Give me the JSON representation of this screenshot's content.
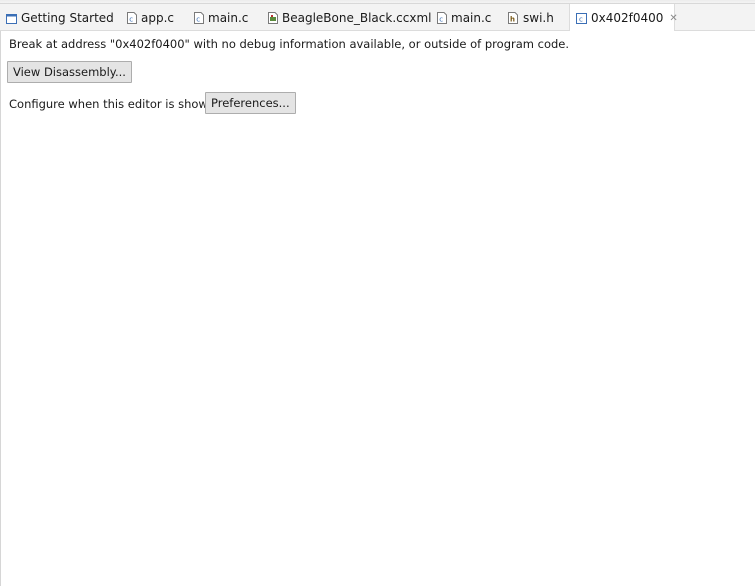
{
  "tabs": [
    {
      "label": "Getting Started",
      "icon": "page-icon"
    },
    {
      "label": "app.c",
      "icon": "c-file-icon"
    },
    {
      "label": "main.c",
      "icon": "c-file-icon"
    },
    {
      "label": "BeagleBone_Black.ccxml",
      "icon": "target-config-icon"
    },
    {
      "label": "main.c",
      "icon": "c-file-icon"
    },
    {
      "label": "swi.h",
      "icon": "header-file-icon"
    },
    {
      "label": "0x402f0400",
      "icon": "c-file-icon",
      "active": true,
      "close_label": "✕"
    }
  ],
  "message": "Break at address \"0x402f0400\" with no debug information available, or outside of program code.",
  "view_disassembly_label": "View Disassembly...",
  "configure_label": "Configure when this editor is shown",
  "preferences_label": "Preferences...",
  "colors": {
    "tabbar_bg": "#f3f3f3",
    "button_bg": "#e4e4e4",
    "button_border": "#adadad",
    "icon_blue": "#3b6fb6"
  }
}
